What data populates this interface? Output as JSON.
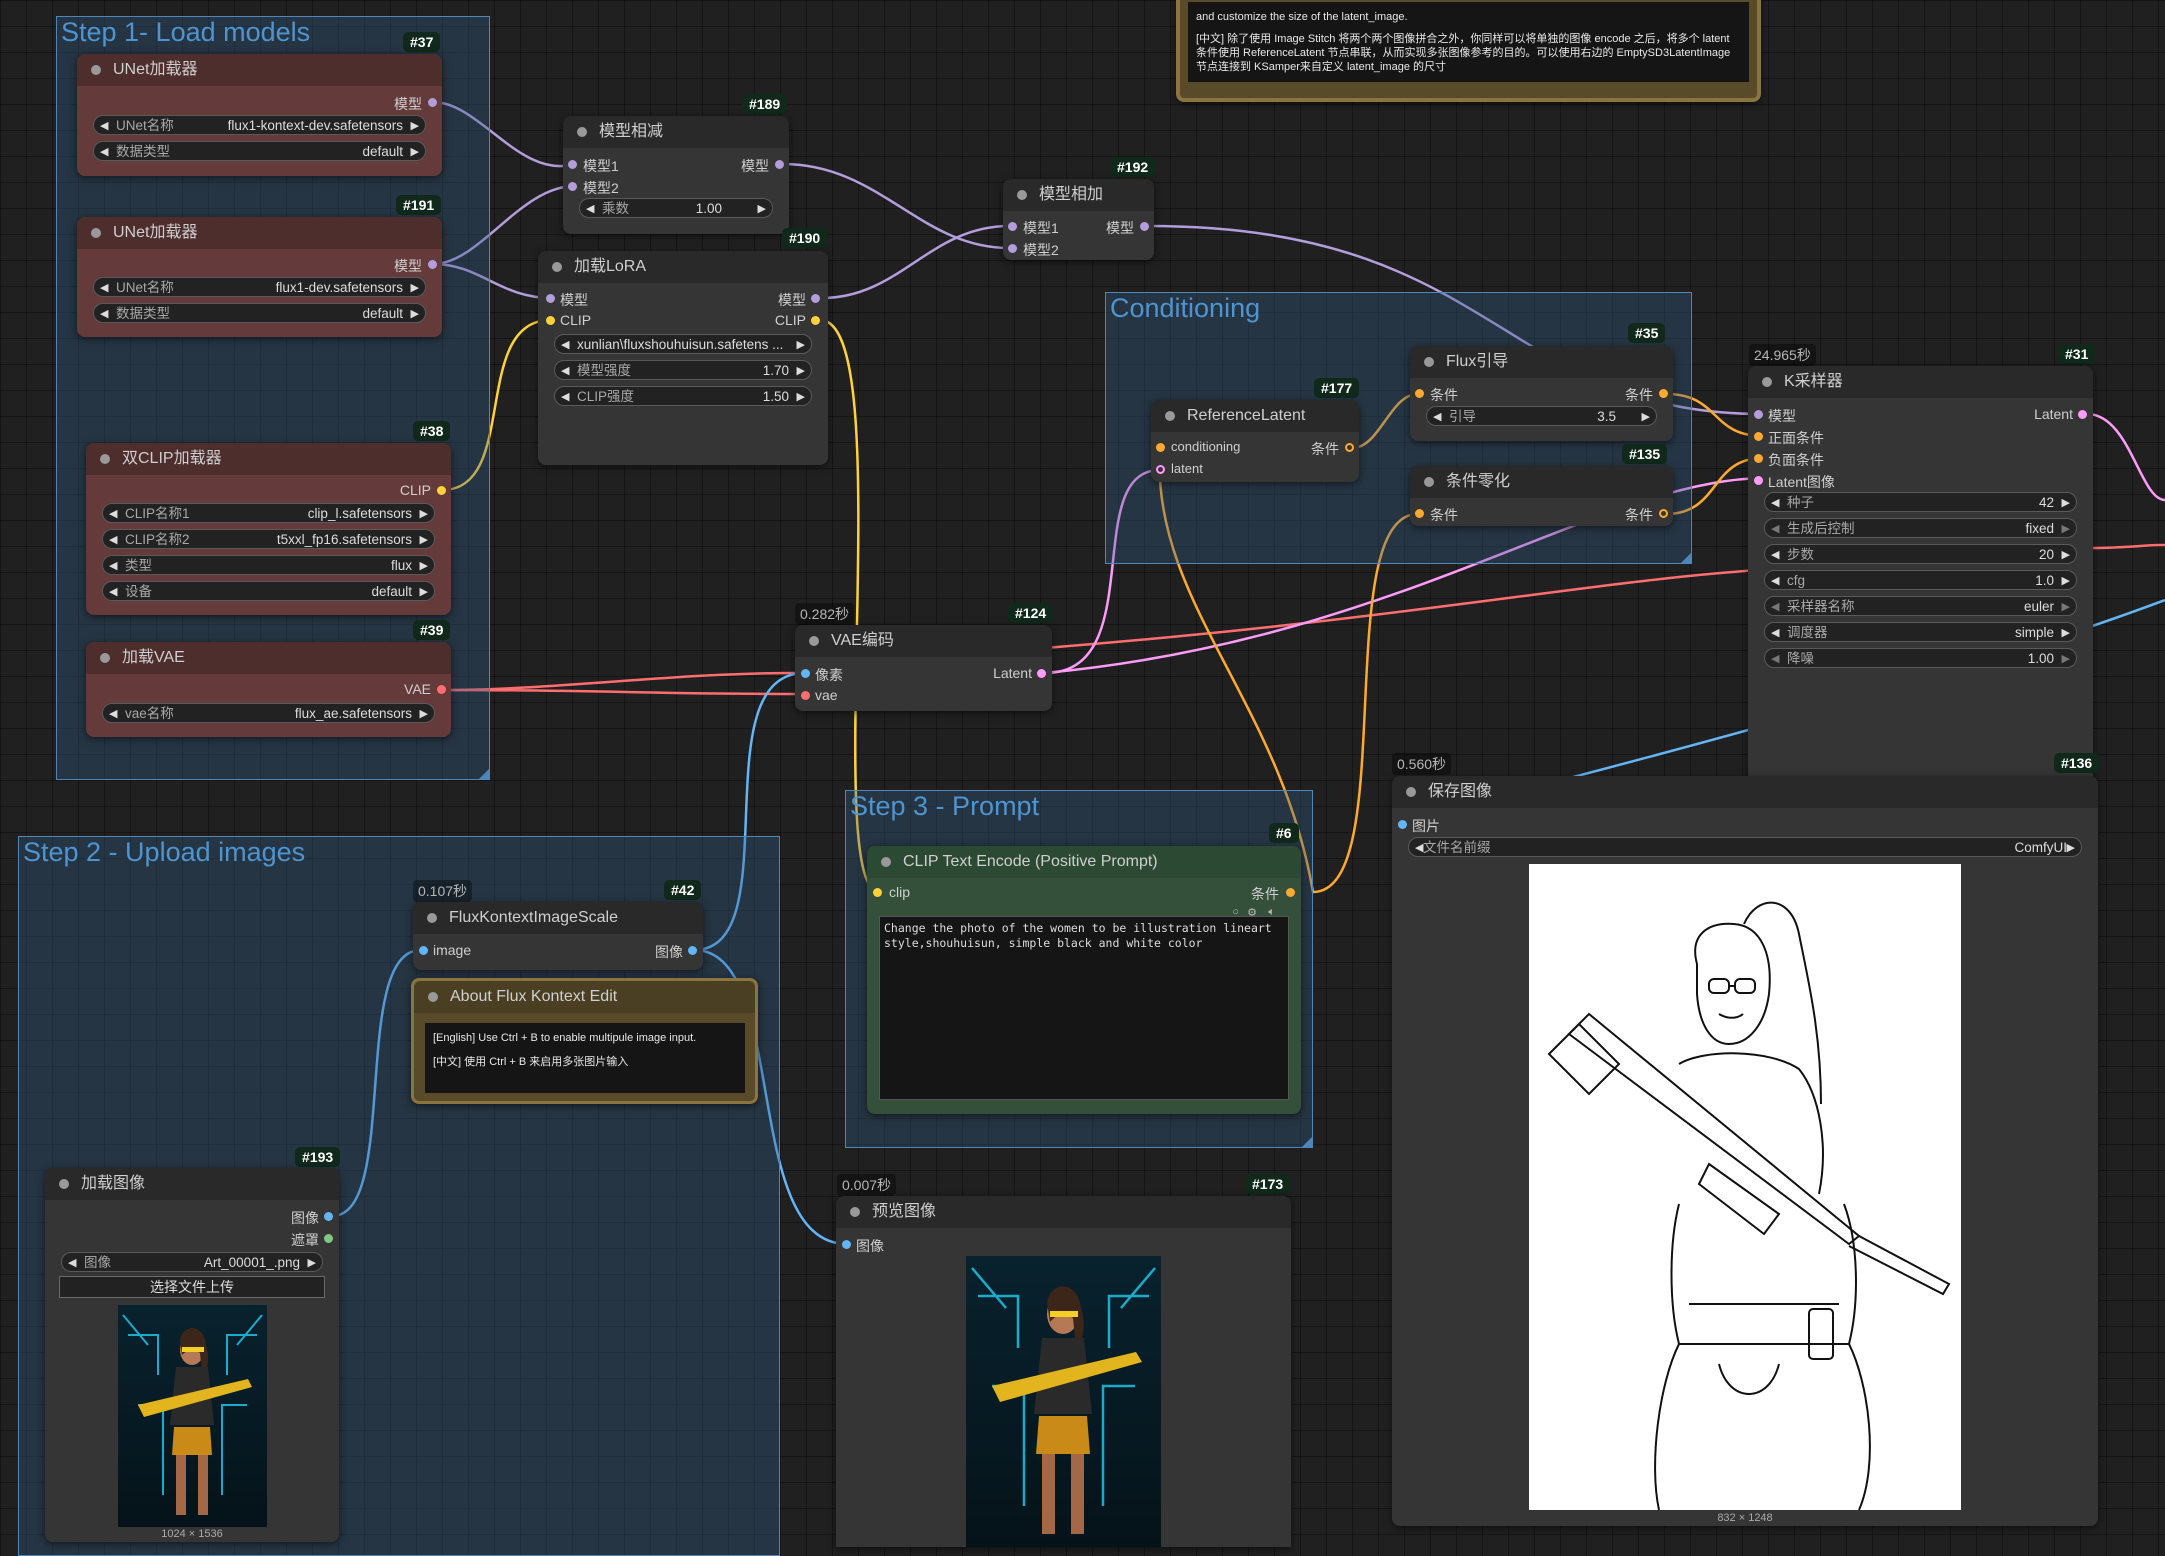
{
  "groups": {
    "step1": "Step 1- Load models",
    "step2": "Step 2 - Upload images",
    "step3": "Step 3 - Prompt",
    "conditioning": "Conditioning"
  },
  "top_note": {
    "en": "and customize the size of the latent_image.",
    "zh": "[中文] 除了使用 Image Stitch 将两个两个图像拼合之外，你同样可以将单独的图像 encode 之后，将多个 latent 条件使用 ReferenceLatent 节点串联，从而实现多张图像参考的目的。可以使用右边的 EmptySD3LatentImage 节点连接到 KSamper来自定义 latent_image 的尺寸"
  },
  "nodes": {
    "n37": {
      "badge": "#37",
      "title": "UNet加载器",
      "out_model": "模型",
      "w_name_label": "UNet名称",
      "w_name_value": "flux1-kontext-dev.safetensors",
      "w_dtype_label": "数据类型",
      "w_dtype_value": "default"
    },
    "n191": {
      "badge": "#191",
      "title": "UNet加载器",
      "out_model": "模型",
      "w_name_label": "UNet名称",
      "w_name_value": "flux1-dev.safetensors",
      "w_dtype_label": "数据类型",
      "w_dtype_value": "default"
    },
    "n38": {
      "badge": "#38",
      "title": "双CLIP加载器",
      "out_clip": "CLIP",
      "w1_label": "CLIP名称1",
      "w1_value": "clip_l.safetensors",
      "w2_label": "CLIP名称2",
      "w2_value": "t5xxl_fp16.safetensors",
      "w3_label": "类型",
      "w3_value": "flux",
      "w4_label": "设备",
      "w4_value": "default"
    },
    "n39": {
      "badge": "#39",
      "title": "加载VAE",
      "out_vae": "VAE",
      "w_label": "vae名称",
      "w_value": "flux_ae.safetensors"
    },
    "n189": {
      "badge": "#189",
      "title": "模型相减",
      "in1": "模型1",
      "in2": "模型2",
      "out": "模型",
      "w_label": "乘数",
      "w_value": "1.00"
    },
    "n190": {
      "badge": "#190",
      "title": "加载LoRA",
      "in_model": "模型",
      "in_clip": "CLIP",
      "out_model": "模型",
      "out_clip": "CLIP",
      "w1_value": "xunlian\\fluxshouhuisun.safetens ...",
      "w2_label": "模型强度",
      "w2_value": "1.70",
      "w3_label": "CLIP强度",
      "w3_value": "1.50"
    },
    "n192": {
      "badge": "#192",
      "title": "模型相加",
      "in1": "模型1",
      "in2": "模型2",
      "out": "模型"
    },
    "n124": {
      "badge": "#124",
      "time": "0.282秒",
      "title": "VAE编码",
      "in_pixels": "像素",
      "in_vae": "vae",
      "out": "Latent"
    },
    "n177": {
      "badge": "#177",
      "title": "ReferenceLatent",
      "in_cond": "conditioning",
      "in_latent": "latent",
      "out": "条件"
    },
    "n35": {
      "badge": "#35",
      "title": "Flux引导",
      "in": "条件",
      "out": "条件",
      "w_label": "引导",
      "w_value": "3.5"
    },
    "n135": {
      "badge": "#135",
      "title": "条件零化",
      "in": "条件",
      "out": "条件"
    },
    "n31": {
      "badge": "#31",
      "time": "24.965秒",
      "title": "K采样器",
      "in_model": "模型",
      "in_pos": "正面条件",
      "in_neg": "负面条件",
      "in_latent": "Latent图像",
      "out": "Latent",
      "widgets": [
        {
          "label": "种子",
          "value": "42"
        },
        {
          "label": "生成后控制",
          "value": "fixed"
        },
        {
          "label": "步数",
          "value": "20"
        },
        {
          "label": "cfg",
          "value": "1.0"
        },
        {
          "label": "采样器名称",
          "value": "euler"
        },
        {
          "label": "调度器",
          "value": "simple"
        },
        {
          "label": "降噪",
          "value": "1.00"
        }
      ]
    },
    "n42": {
      "badge": "#42",
      "time": "0.107秒",
      "title": "FluxKontextImageScale",
      "in": "image",
      "out": "图像"
    },
    "note": {
      "title": "About Flux Kontext Edit",
      "en": "[English] Use Ctrl + B to enable multipule image input.",
      "zh": "[中文] 使用 Ctrl + B 来启用多张图片输入"
    },
    "n6": {
      "badge": "#6",
      "title": "CLIP Text Encode (Positive Prompt)",
      "in": "clip",
      "out": "条件",
      "prompt": "Change the photo of the women to be illustration lineart style,shouhuisun, simple black and white color"
    },
    "n193": {
      "badge": "#193",
      "title": "加载图像",
      "out_image": "图像",
      "out_mask": "遮罩",
      "w_label": "图像",
      "w_value": "Art_00001_.png",
      "upload": "选择文件上传",
      "dims": "1024 × 1536"
    },
    "n173": {
      "badge": "#173",
      "time": "0.007秒",
      "title": "预览图像",
      "in": "图像"
    },
    "n136": {
      "badge": "#136",
      "time": "0.560秒",
      "title": "保存图像",
      "in": "图片",
      "w_label": "文件名前缀",
      "w_value": "ComfyUI",
      "dims": "832 × 1248"
    }
  },
  "colors": {
    "model": "#b39ddb",
    "clip": "#ffd23c",
    "vae": "#ff6e6e",
    "latent": "#ff9cf9",
    "conditioning": "#ffa931",
    "image": "#64b5f6",
    "mask": "#81c784"
  }
}
